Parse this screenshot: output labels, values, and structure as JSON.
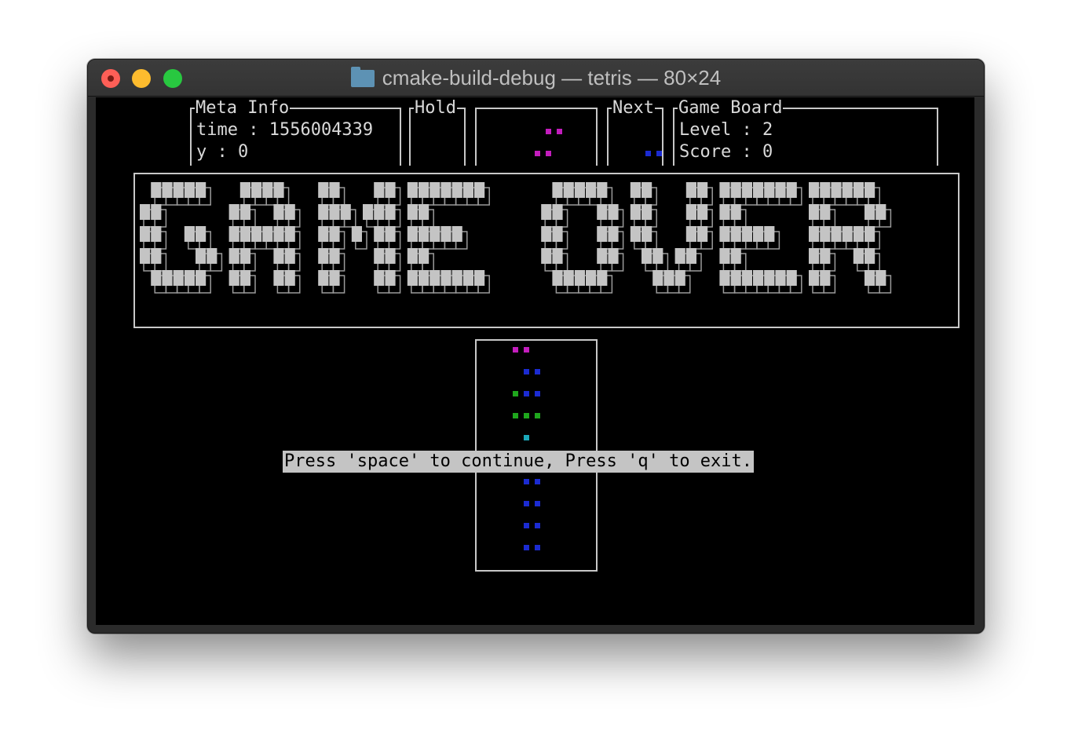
{
  "window": {
    "title": "cmake-build-debug — tetris — 80×24"
  },
  "meta_info": {
    "label": "Meta Info",
    "time_line": "time : 1556004339",
    "y_line": "y : 0"
  },
  "hold": {
    "label": "Hold"
  },
  "next": {
    "label": "Next"
  },
  "game_board": {
    "label": "Game Board",
    "level_line": "Level : 2",
    "score_line": "Score : 0"
  },
  "game_over": {
    "text": "GAME OVER"
  },
  "prompt": {
    "message": "Press 'space' to continue, Press 'q' to exit."
  },
  "colors": {
    "magenta": "#c31dbd",
    "blue": "#1b2bd1",
    "green": "#1fa61d",
    "cyan": "#1aa7b8",
    "text": "#d9d9d9",
    "block": "#c4c4c4"
  },
  "blocks": {
    "hold_piece": [
      {
        "row": 0,
        "cols": [
          3,
          4
        ],
        "color": "magenta"
      },
      {
        "row": 1,
        "cols": [
          2,
          3
        ],
        "color": "magenta"
      }
    ],
    "next_piece": [
      {
        "row": 1,
        "cols": [
          3,
          4
        ],
        "color": "blue"
      }
    ],
    "board": [
      {
        "row": 0,
        "cols": [
          0,
          1
        ],
        "color": "magenta"
      },
      {
        "row": 1,
        "cols": [
          1,
          2
        ],
        "color": "blue"
      },
      {
        "row": 2,
        "cols": [
          0
        ],
        "color": "green"
      },
      {
        "row": 2,
        "cols": [
          1,
          2
        ],
        "color": "blue"
      },
      {
        "row": 3,
        "cols": [
          0,
          1,
          2
        ],
        "color": "green"
      },
      {
        "row": 4,
        "cols": [
          1
        ],
        "color": "cyan"
      },
      {
        "row": 6,
        "cols": [
          1,
          2
        ],
        "color": "blue"
      },
      {
        "row": 7,
        "cols": [
          1,
          2
        ],
        "color": "blue"
      },
      {
        "row": 8,
        "cols": [
          1,
          2
        ],
        "color": "blue"
      },
      {
        "row": 9,
        "cols": [
          1,
          2
        ],
        "color": "blue"
      }
    ]
  }
}
